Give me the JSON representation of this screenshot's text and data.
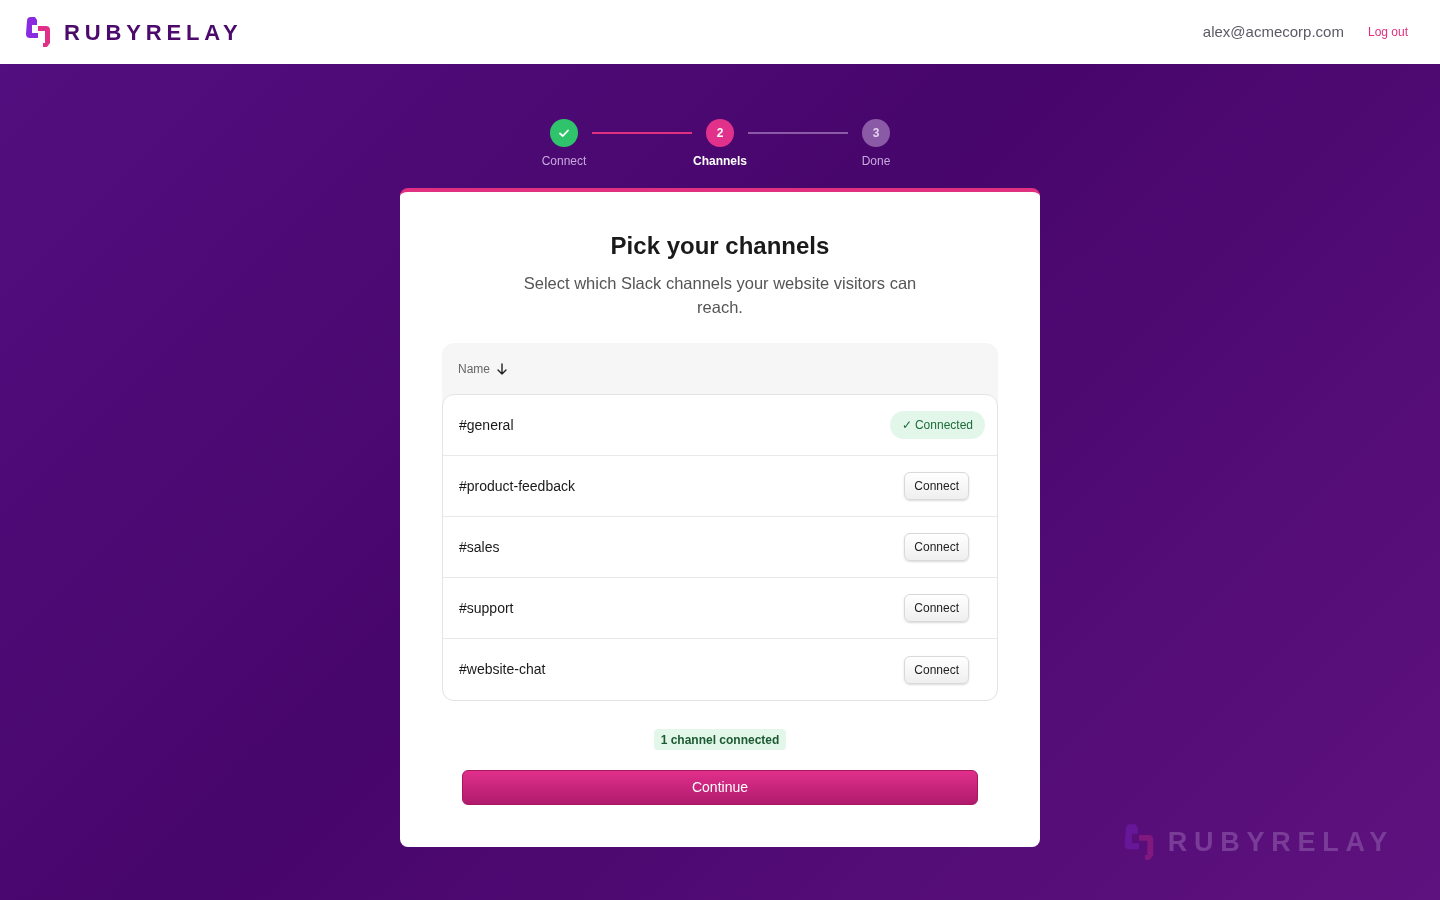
{
  "header": {
    "brand": "RUBYRELAY",
    "user_email": "alex@acmecorp.com",
    "logout_link": "Log out"
  },
  "steps": [
    {
      "label": "Connect",
      "done": true,
      "selected": false
    },
    {
      "number": "2",
      "label": "Channels",
      "done": false,
      "selected": true
    },
    {
      "number": "3",
      "label": "Done",
      "done": false,
      "selected": false
    }
  ],
  "card": {
    "title": "Pick your channels",
    "subtitle": "Select which Slack channels your website visitors can reach.",
    "table": {
      "columns": [
        {
          "label": "Name",
          "sorted": true
        }
      ],
      "rows": [
        {
          "name": "#general",
          "connected": true,
          "action": "✓ Connected"
        },
        {
          "name": "#product-feedback",
          "connected": false,
          "action": "Connect"
        },
        {
          "name": "#sales",
          "connected": false,
          "action": "Connect"
        },
        {
          "name": "#support",
          "connected": false,
          "action": "Connect"
        },
        {
          "name": "#website-chat",
          "connected": false,
          "action": "Connect"
        }
      ]
    },
    "summary": "1 channel connected",
    "continue_button": "Continue"
  },
  "background_brand": "RUBYRELAY"
}
